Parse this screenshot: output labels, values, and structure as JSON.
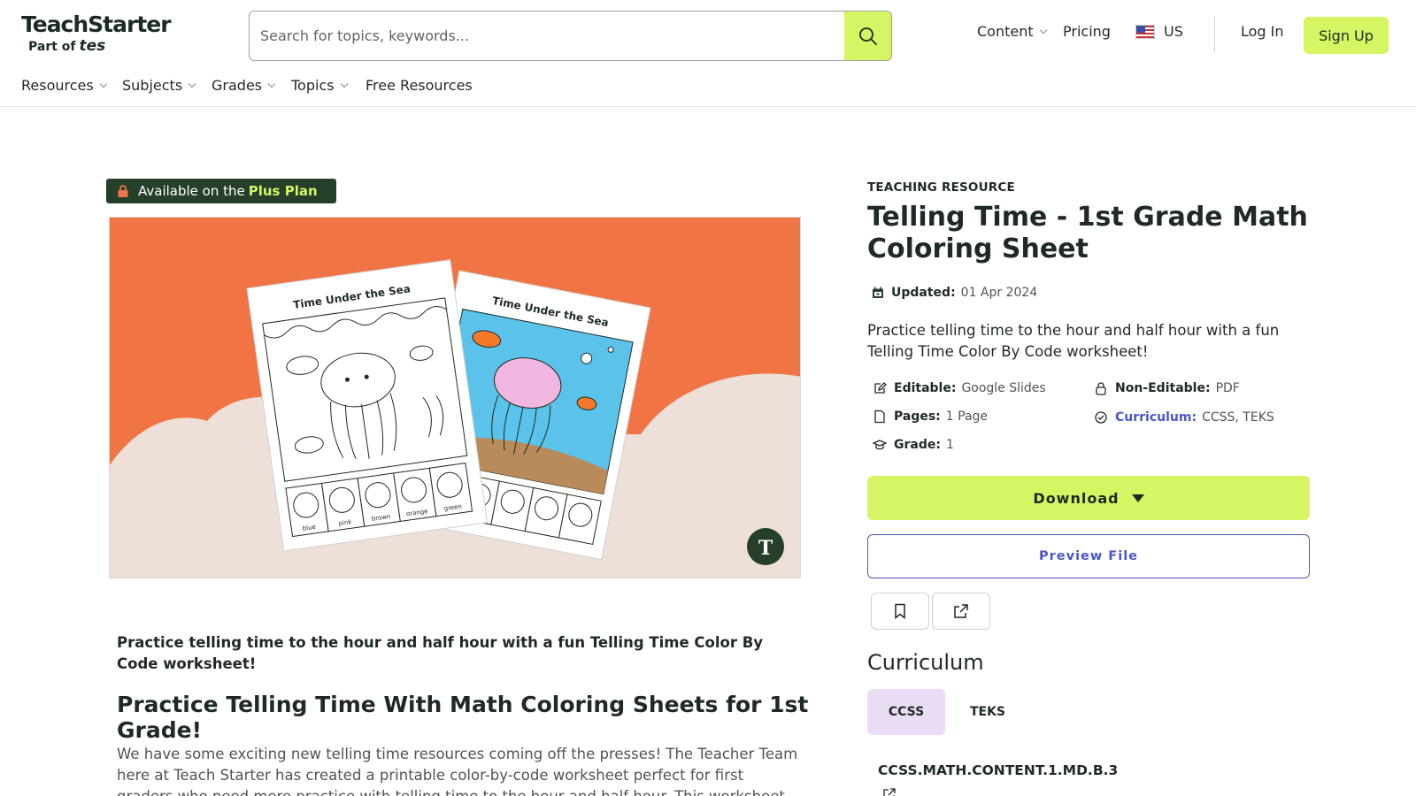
{
  "header": {
    "logo_main": "TeachStarter",
    "logo_sub_prefix": "Part of",
    "logo_sub_brand": "tes",
    "search_placeholder": "Search for topics, keywords...",
    "nav": {
      "content": "Content",
      "pricing": "Pricing",
      "region": "US",
      "login": "Log In",
      "signup": "Sign Up"
    },
    "subnav": {
      "resources": "Resources",
      "subjects": "Subjects",
      "grades": "Grades",
      "topics": "Topics",
      "free": "Free Resources"
    }
  },
  "badge": {
    "prefix": "Available on the",
    "plan": "Plus Plan"
  },
  "hero_image": {
    "sheet_title": "Time Under the Sea",
    "clock_labels": [
      "6:30",
      "8:00",
      "11:00",
      "6:30",
      "12:30",
      "9:30",
      "12:30",
      "6:30",
      "5:30"
    ],
    "color_words": [
      "blue",
      "pink",
      "brown",
      "orange",
      "green"
    ],
    "colors": {
      "background": "#f07444",
      "sand": "#eee0d9",
      "water": "#5bc3ea",
      "jellyfish": "#f2b7e0",
      "fish": "#f47a2a"
    }
  },
  "resource": {
    "kicker": "TEACHING RESOURCE",
    "title": "Telling Time - 1st Grade Math Coloring Sheet",
    "updated_label": "Updated:",
    "updated_value": "01 Apr 2024",
    "summary": "Practice telling time to the hour and half hour with a fun Telling Time Color By Code worksheet!",
    "editable_label": "Editable:",
    "editable_value": "Google Slides",
    "noneditable_label": "Non-Editable:",
    "noneditable_value": "PDF",
    "pages_label": "Pages:",
    "pages_value": "1 Page",
    "curriculum_label": "Curriculum:",
    "curriculum_value": "CCSS, TEKS",
    "grade_label": "Grade:",
    "grade_value": "1",
    "download_label": "Download",
    "preview_label": "Preview File"
  },
  "curriculum": {
    "heading": "Curriculum",
    "tabs": [
      "CCSS",
      "TEKS"
    ],
    "active_tab": "CCSS",
    "code": "CCSS.MATH.CONTENT.1.MD.B.3"
  },
  "description": {
    "intro": "Practice telling time to the hour and half hour with a fun Telling Time Color By Code worksheet!",
    "heading": "Practice Telling Time With Math Coloring Sheets for 1st Grade!",
    "body": "We have some exciting new telling time resources coming off the presses! The Teacher Team here at Teach Starter has created a printable color-by-code worksheet perfect for first graders who need more practice with telling time to the hour and half hour. This worksheet is geared"
  },
  "theme": {
    "accent": "#d6f562",
    "link": "#4a57c9",
    "badge_bg": "#253f2b",
    "tab_active": "#eadcf5"
  }
}
